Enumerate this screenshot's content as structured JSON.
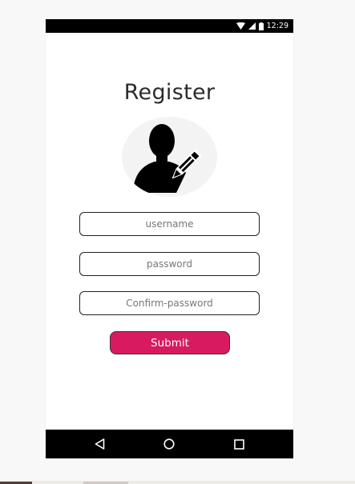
{
  "status_bar": {
    "time": "12:29",
    "icons": [
      "wifi-icon",
      "cell-signal-icon",
      "battery-icon"
    ]
  },
  "register": {
    "title": "Register",
    "avatar_icon": "user-edit-icon",
    "fields": {
      "username": {
        "placeholder": "username",
        "value": ""
      },
      "password": {
        "placeholder": "password",
        "value": ""
      },
      "confirm_password": {
        "placeholder": "Confirm-password",
        "value": ""
      }
    },
    "submit_label": "Submit"
  },
  "nav_bar": {
    "buttons": [
      "back-icon",
      "home-icon",
      "recents-icon"
    ]
  },
  "colors": {
    "accent": "#d81b60",
    "status_bar": "#000000",
    "nav_bar": "#000000",
    "text": "#2b2b2b"
  }
}
